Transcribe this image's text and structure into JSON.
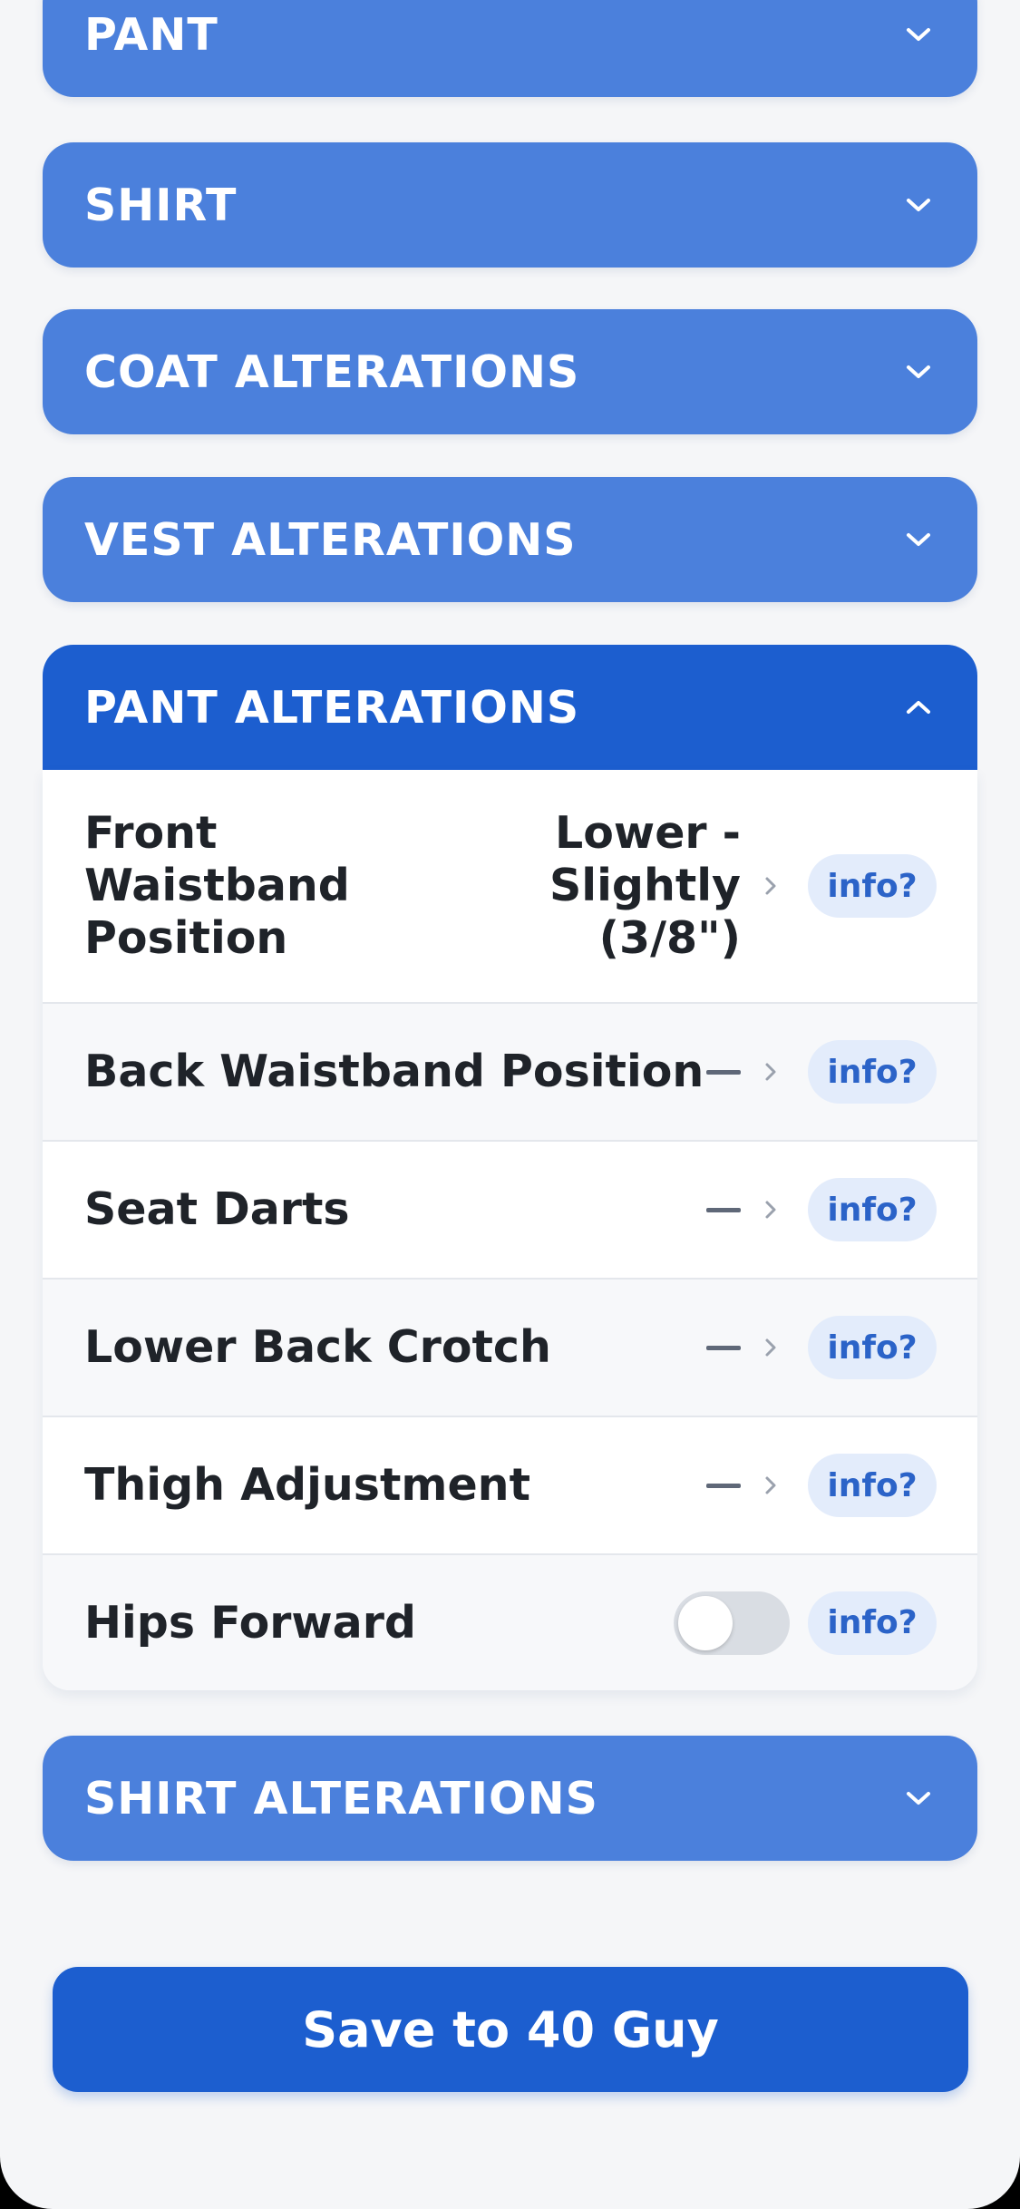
{
  "sections": {
    "pant": "PANT",
    "shirt": "SHIRT",
    "coat_alterations": "COAT ALTERATIONS",
    "vest_alterations": "VEST ALTERATIONS",
    "pant_alterations": "PANT ALTERATIONS",
    "shirt_alterations": "SHIRT ALTERATIONS"
  },
  "pant_alterations": {
    "expanded": true,
    "rows": [
      {
        "label": "Front Waistband Position",
        "value": "Lower - Slightly (3/8\")",
        "info": "info?"
      },
      {
        "label": "Back Waistband Position",
        "value": "—",
        "info": "info?"
      },
      {
        "label": "Seat Darts",
        "value": "—",
        "info": "info?"
      },
      {
        "label": "Lower Back Crotch",
        "value": "—",
        "info": "info?"
      },
      {
        "label": "Thigh Adjustment",
        "value": "—",
        "info": "info?"
      },
      {
        "label": "Hips Forward",
        "toggle": false,
        "info": "info?"
      }
    ]
  },
  "save_button": {
    "label": "Save to 40 Guy"
  },
  "icons": {
    "collapsed": "chevron-down-icon",
    "expanded": "chevron-up-icon",
    "row": "chevron-right-icon"
  },
  "colors": {
    "section_header": "#4b80dc",
    "section_header_open": "#1c5ecf",
    "primary_button": "#1c5ecf",
    "info_chip_bg": "#e3ecfb",
    "info_chip_text": "#2b63c8",
    "background": "#f5f6f8"
  }
}
